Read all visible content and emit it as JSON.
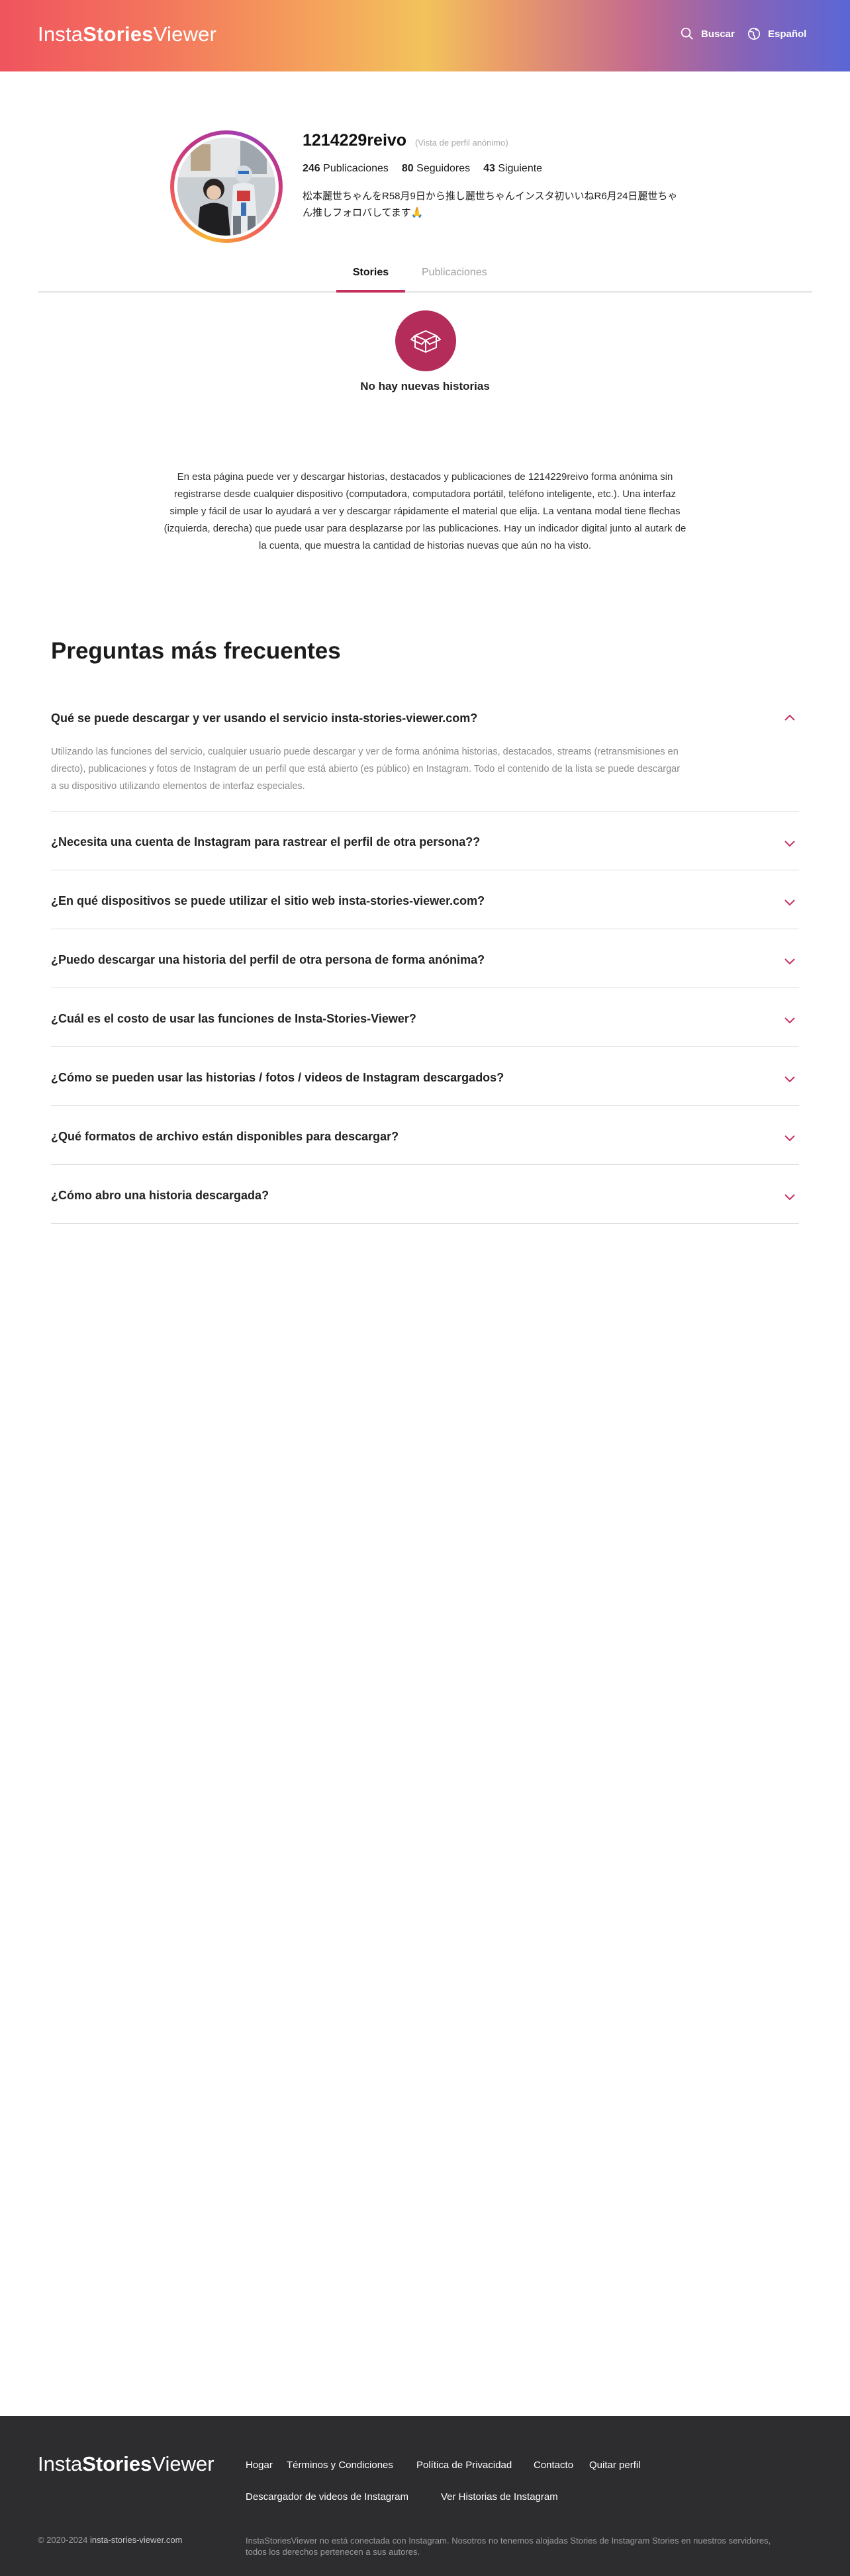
{
  "header": {
    "logo_part1": "Insta",
    "logo_part2": "Stories",
    "logo_part3": "Viewer",
    "search_label": "Buscar",
    "language_label": "Español"
  },
  "profile": {
    "username": "1214229reivo",
    "anon_note": "(Vista de perfil anónimo)",
    "posts_count": "246",
    "posts_label": "Publicaciones",
    "followers_count": "80",
    "followers_label": "Seguidores",
    "following_count": "43",
    "following_label": "Siguiente",
    "bio": "松本麗世ちゃんをR58月9日から推し麗世ちゃんインスタ初いいねR6月24日麗世ちゃん推しフォロバしてます🙏"
  },
  "tabs": [
    {
      "label": "Stories",
      "active": true
    },
    {
      "label": "Publicaciones",
      "active": false
    }
  ],
  "empty_state": {
    "icon": "open-box-icon",
    "text": "No hay nuevas historias"
  },
  "description": "En esta página puede ver y descargar historias, destacados y publicaciones de 1214229reivo forma anónima sin registrarse desde cualquier dispositivo (computadora, computadora portátil, teléfono inteligente, etc.). Una interfaz simple y fácil de usar lo ayudará a ver y descargar rápidamente el material que elija. La ventana modal tiene flechas (izquierda, derecha) que puede usar para desplazarse por las publicaciones. Hay un indicador digital junto al autark de la cuenta, que muestra la cantidad de historias nuevas que aún no ha visto.",
  "faq": {
    "title": "Preguntas más frecuentes",
    "items": [
      {
        "q": "Qué se puede descargar y ver usando el servicio insta-stories-viewer.com?",
        "expanded": true,
        "a": "Utilizando las funciones del servicio, cualquier usuario puede descargar y ver de forma anónima historias, destacados, streams (retransmisiones en directo), publicaciones y fotos de Instagram de un perfil que está abierto (es público) en Instagram. Todo el contenido de la lista se puede descargar a su dispositivo utilizando elementos de interfaz especiales."
      },
      {
        "q": "¿Necesita una cuenta de Instagram para rastrear el perfil de otra persona??",
        "expanded": false
      },
      {
        "q": "¿En qué dispositivos se puede utilizar el sitio web insta-stories-viewer.com?",
        "expanded": false
      },
      {
        "q": "¿Puedo descargar una historia del perfil de otra persona de forma anónima?",
        "expanded": false
      },
      {
        "q": "¿Cuál es el costo de usar las funciones de Insta-Stories-Viewer?",
        "expanded": false
      },
      {
        "q": "¿Cómo se pueden usar las historias / fotos / videos de Instagram descargados?",
        "expanded": false
      },
      {
        "q": "¿Qué formatos de archivo están disponibles para descargar?",
        "expanded": false
      },
      {
        "q": "¿Cómo abro una historia descargada?",
        "expanded": false
      }
    ]
  },
  "footer": {
    "logo_part1": "Insta",
    "logo_part2": "Stories",
    "logo_part3": "Viewer",
    "links_row1": [
      "Hogar",
      "Términos y Condiciones",
      "Política de Privacidad",
      "Contacto",
      "Quitar perfil"
    ],
    "links_row2": [
      "Descargador de videos de Instagram",
      "Ver Historias de Instagram"
    ],
    "copyright_prefix": "© 2020-2024",
    "copyright_site": "insta-stories-viewer.com",
    "note": "InstaStoriesViewer no está conectada con Instagram. Nosotros no tenemos alojadas Stories de Instagram Stories en nuestros servidores, todos los derechos pertenecen a sus autores."
  },
  "colors": {
    "accent": "#c42f5c",
    "footer_bg": "#2d2c2f"
  }
}
